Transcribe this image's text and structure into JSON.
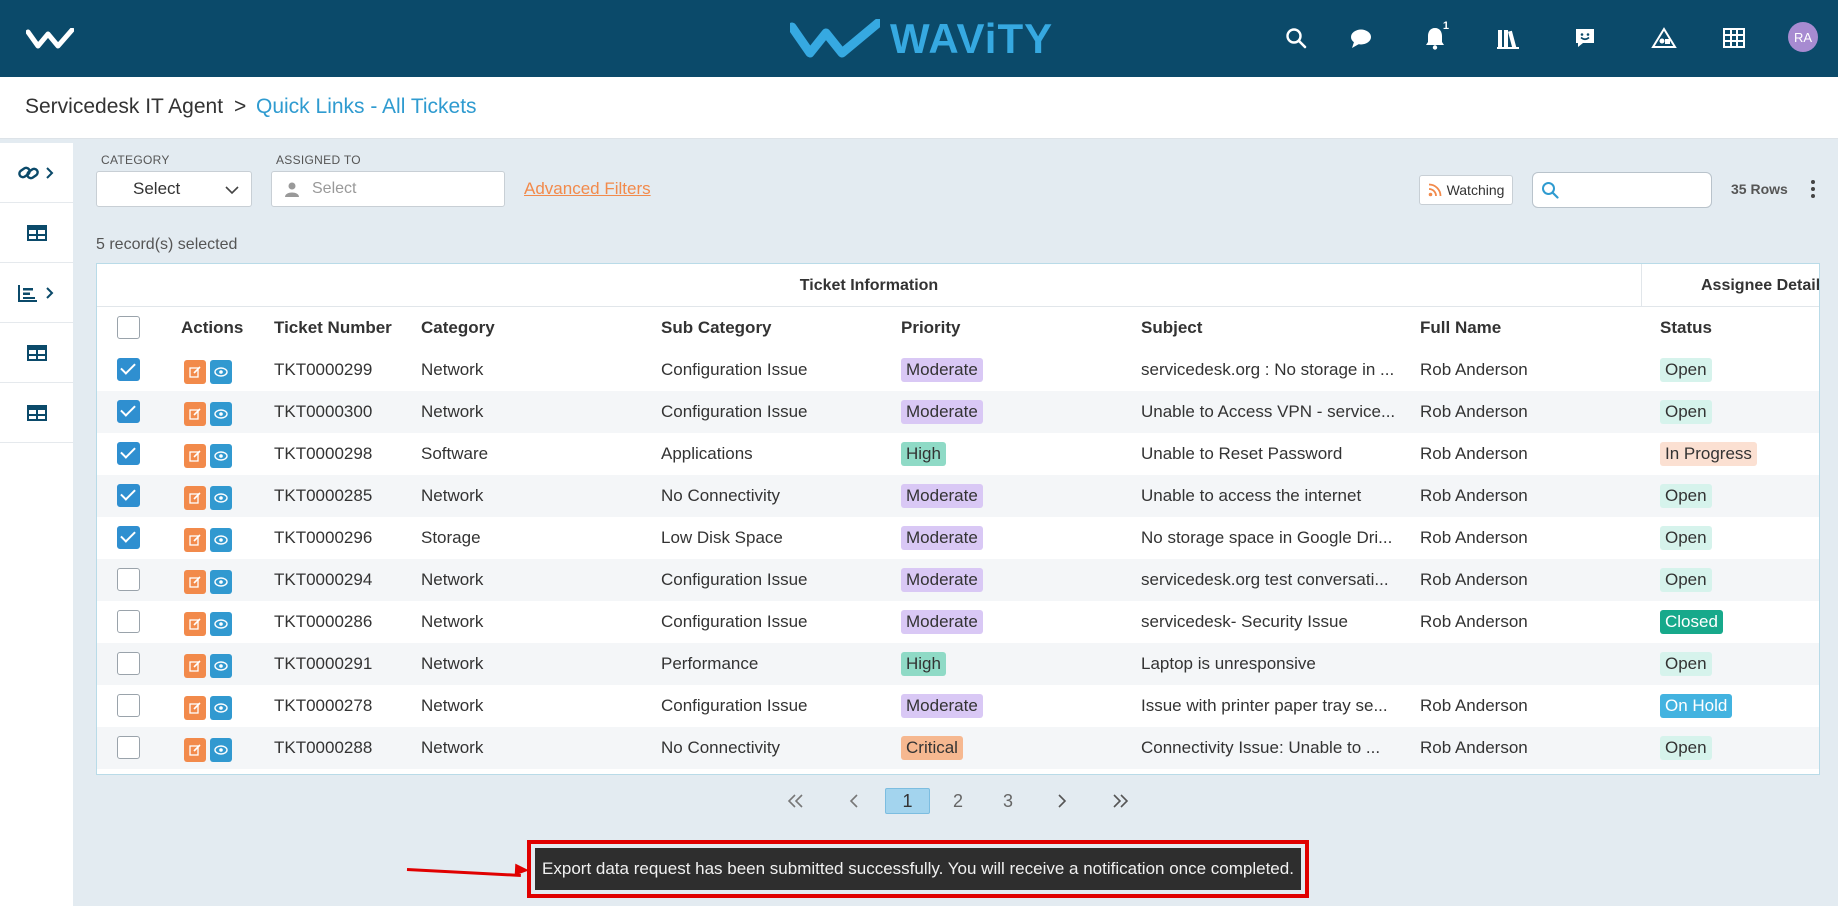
{
  "header": {
    "logo_text": "WAViTY",
    "notification_count": "1",
    "avatar_initials": "RA"
  },
  "breadcrumb": {
    "root": "Servicedesk IT Agent",
    "separator": ">",
    "current": "Quick Links - All Tickets"
  },
  "filters": {
    "category_label": "CATEGORY",
    "category_value": "Select",
    "assigned_label": "ASSIGNED TO",
    "assigned_placeholder": "Select",
    "advanced_filters": "Advanced Filters",
    "watching": "Watching",
    "rows_count": "35 Rows"
  },
  "records_selected": "5 record(s) selected",
  "table": {
    "group_ticket": "Ticket Information",
    "group_assignee": "Assignee Details",
    "columns": [
      "Actions",
      "Ticket Number",
      "Category",
      "Sub Category",
      "Priority",
      "Subject",
      "Full Name",
      "Status"
    ],
    "rows": [
      {
        "checked": true,
        "ticket": "TKT0000299",
        "category": "Network",
        "sub_category": "Configuration Issue",
        "priority": "Moderate",
        "subject": "servicedesk.org : No storage in ...",
        "full_name": "Rob Anderson",
        "status": "Open"
      },
      {
        "checked": true,
        "ticket": "TKT0000300",
        "category": "Network",
        "sub_category": "Configuration Issue",
        "priority": "Moderate",
        "subject": "Unable to Access VPN - service...",
        "full_name": "Rob Anderson",
        "status": "Open"
      },
      {
        "checked": true,
        "ticket": "TKT0000298",
        "category": "Software",
        "sub_category": "Applications",
        "priority": "High",
        "subject": "Unable to Reset Password",
        "full_name": "Rob Anderson",
        "status": "In Progress"
      },
      {
        "checked": true,
        "ticket": "TKT0000285",
        "category": "Network",
        "sub_category": "No Connectivity",
        "priority": "Moderate",
        "subject": "Unable to access the internet",
        "full_name": "Rob Anderson",
        "status": "Open"
      },
      {
        "checked": true,
        "ticket": "TKT0000296",
        "category": "Storage",
        "sub_category": "Low Disk Space",
        "priority": "Moderate",
        "subject": "No storage space in Google Dri...",
        "full_name": "Rob Anderson",
        "status": "Open"
      },
      {
        "checked": false,
        "ticket": "TKT0000294",
        "category": "Network",
        "sub_category": "Configuration Issue",
        "priority": "Moderate",
        "subject": "servicedesk.org test conversati...",
        "full_name": "Rob Anderson",
        "status": "Open"
      },
      {
        "checked": false,
        "ticket": "TKT0000286",
        "category": "Network",
        "sub_category": "Configuration Issue",
        "priority": "Moderate",
        "subject": "servicedesk- Security Issue",
        "full_name": "Rob Anderson",
        "status": "Closed"
      },
      {
        "checked": false,
        "ticket": "TKT0000291",
        "category": "Network",
        "sub_category": "Performance",
        "priority": "High",
        "subject": "Laptop is unresponsive",
        "full_name": "",
        "status": "Open"
      },
      {
        "checked": false,
        "ticket": "TKT0000278",
        "category": "Network",
        "sub_category": "Configuration Issue",
        "priority": "Moderate",
        "subject": "Issue with printer paper tray se...",
        "full_name": "Rob Anderson",
        "status": "On Hold"
      },
      {
        "checked": false,
        "ticket": "TKT0000288",
        "category": "Network",
        "sub_category": "No Connectivity",
        "priority": "Critical",
        "subject": "Connectivity Issue: Unable to ...",
        "full_name": "Rob Anderson",
        "status": "Open"
      }
    ]
  },
  "pagination": {
    "pages": [
      "1",
      "2",
      "3"
    ],
    "current": "1"
  },
  "toast": {
    "message": "Export data request has been submitted successfully. You will receive a notification once completed."
  },
  "colors": {
    "header_bg": "#0b4a6a",
    "accent_blue": "#2f9bd0",
    "accent_orange": "#f28a4b",
    "highlight_red": "#e00000"
  }
}
